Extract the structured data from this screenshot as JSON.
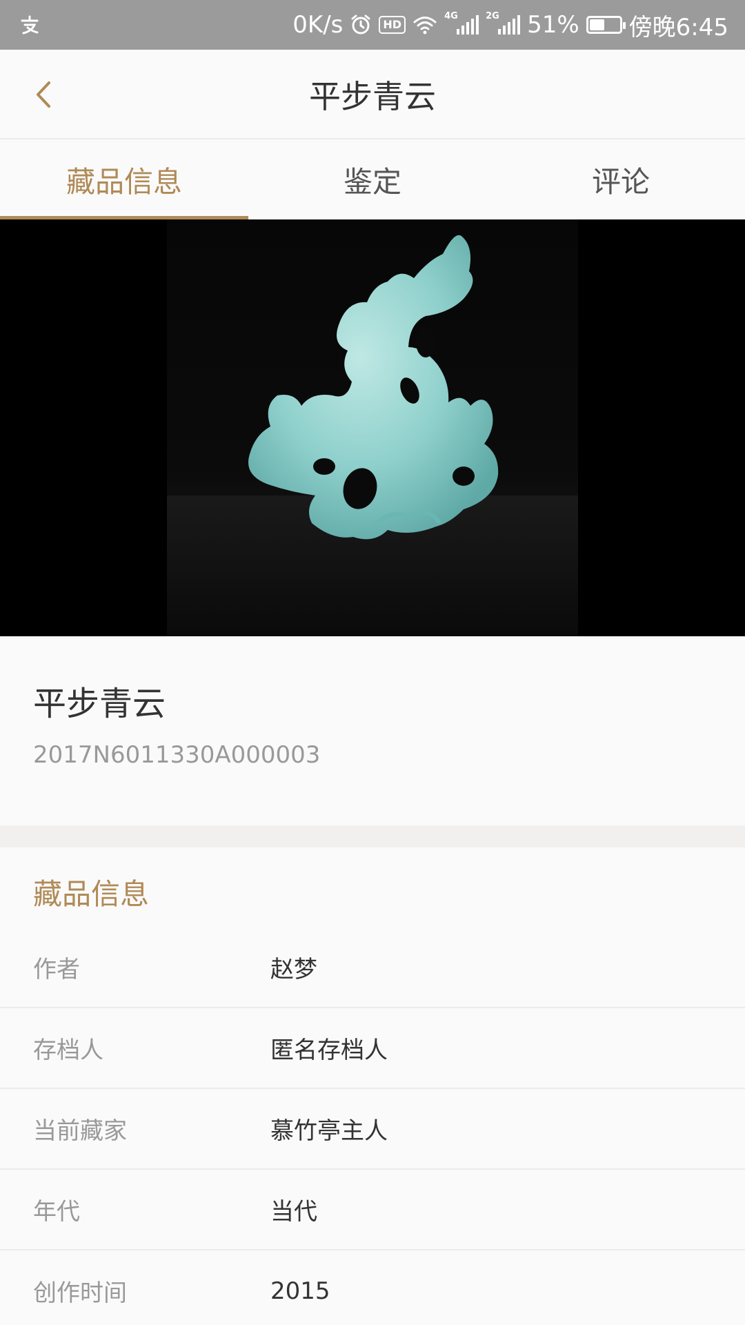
{
  "status_bar": {
    "left_icon": "alipay-icon",
    "speed": "0K/s",
    "alarm_icon": "alarm-icon",
    "hd_label": "HD",
    "wifi_icon": "wifi-icon",
    "signal_1_label": "4G",
    "signal_2_label": "2G",
    "battery_percent": "51%",
    "battery_level": 0.51,
    "time": "傍晚6:45"
  },
  "header": {
    "back_icon": "chevron-left-icon",
    "title": "平步青云"
  },
  "tabs": [
    {
      "label": "藏品信息",
      "active": true
    },
    {
      "label": "鉴定",
      "active": false
    },
    {
      "label": "评论",
      "active": false
    }
  ],
  "item": {
    "name": "平步青云",
    "code": "2017N6011330A000003"
  },
  "info": {
    "section_title": "藏品信息",
    "rows": [
      {
        "label": "作者",
        "value": "赵梦"
      },
      {
        "label": "存档人",
        "value": "匿名存档人"
      },
      {
        "label": "当前藏家",
        "value": "慕竹亭主人"
      },
      {
        "label": "年代",
        "value": "当代"
      },
      {
        "label": "创作时间",
        "value": "2015"
      }
    ]
  },
  "colors": {
    "accent": "#b08a57",
    "status_bar": "#9b9b9b",
    "celadon": "#8fd0cc"
  }
}
